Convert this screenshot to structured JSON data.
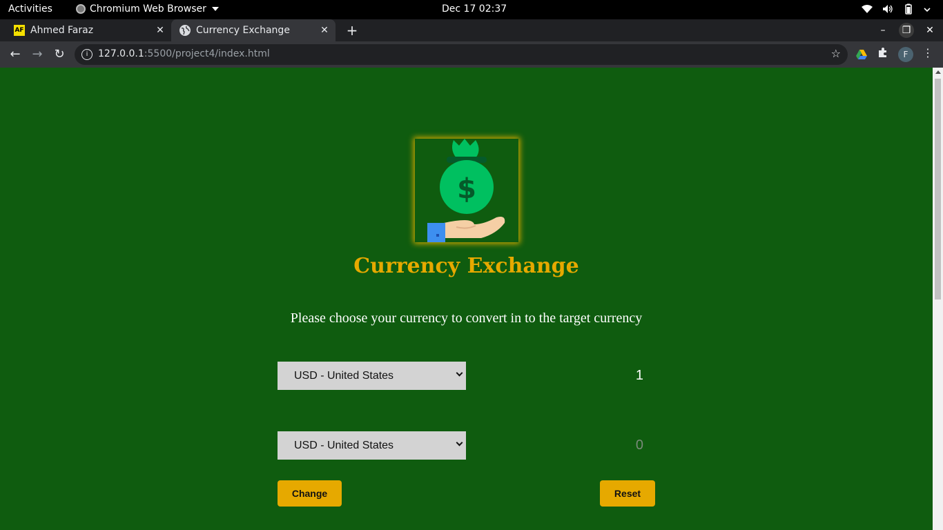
{
  "system": {
    "activities": "Activities",
    "app_name": "Chromium Web Browser",
    "clock": "Dec 17  02:37"
  },
  "tabs": [
    {
      "label": "Ahmed Faraz",
      "favicon_text": "AF",
      "active": false
    },
    {
      "label": "Currency Exchange",
      "active": true
    }
  ],
  "toolbar": {
    "url_host": "127.0.0.1",
    "url_path": ":5500/project4/index.html",
    "profile_initial": "F"
  },
  "page": {
    "heading": "Currency Exchange",
    "subtitle": "Please choose your currency to convert in to the target currency",
    "from_currency": "USD - United States",
    "from_amount": "1",
    "to_currency": "USD - United States",
    "to_amount": "0",
    "change_label": "Change",
    "reset_label": "Reset"
  },
  "colors": {
    "page_bg": "#0f5c0f",
    "accent": "#e6a900"
  }
}
